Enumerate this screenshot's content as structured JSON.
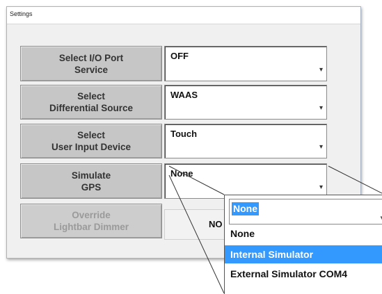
{
  "window": {
    "title": "Settings"
  },
  "settings": [
    {
      "button": [
        "Select I/O Port",
        "Service"
      ],
      "value": "OFF"
    },
    {
      "button": [
        "Select",
        "Differential Source"
      ],
      "value": "WAAS"
    },
    {
      "button": [
        "Select",
        "User Input Device"
      ],
      "value": "Touch"
    },
    {
      "button": [
        "Simulate",
        "GPS"
      ],
      "value": "None"
    }
  ],
  "override": {
    "button": [
      "Override",
      "Lightbar Dimmer"
    ],
    "value_partial": "NO"
  },
  "dropdown_callout": {
    "current": "None",
    "options": [
      "None",
      "Internal Simulator",
      "External Simulator COM4"
    ],
    "highlighted": "Internal Simulator"
  },
  "icons": {
    "combo_arrow": "chevron-down-icon"
  },
  "colors": {
    "selection": "#3399ff",
    "button_bg": "#c6c6c6",
    "window_bg": "#f0f0f0"
  }
}
